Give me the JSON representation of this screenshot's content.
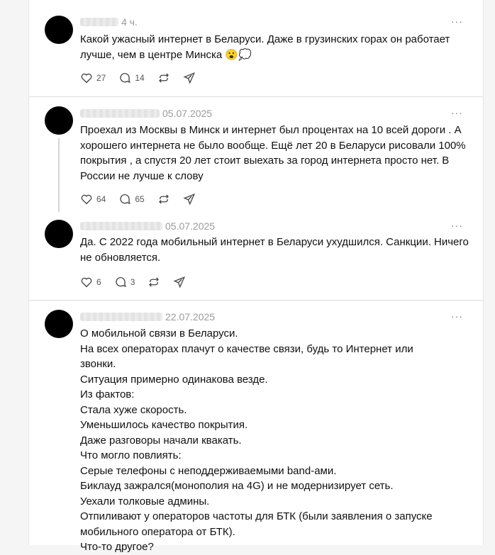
{
  "posts": [
    {
      "time": "4 ч.",
      "text": "Какой ужасный интернет в Беларуси. Даже в грузинских горах он работает лучше, чем в центре Минска 😮💭",
      "likes": "27",
      "replies": "14"
    },
    {
      "time": "05.07.2025",
      "text": "Проехал из Москвы в Минск и интернет был процентах на 10 всей дороги . А хорошего интернета не было вообще. Ещё лет 20 в Беларуси рисовали 100% покрытия , а спустя 20 лет стоит выехать за город интернета просто нет. В России не лучше к слову",
      "likes": "64",
      "replies": "65"
    },
    {
      "time": "05.07.2025",
      "text": "Да. С 2022 года мобильный интернет в Беларуси ухудшился. Санкции. Ничего не обновляется.",
      "likes": "6",
      "replies": "3"
    },
    {
      "time": "22.07.2025",
      "text": "О мобильной связи в Беларуси.\nНа всех операторах плачут о качестве связи, будь то Интернет или звонки.\nСитуация примерно одинакова везде.\nИз фактов:\nСтала хуже скорость.\nУменьшилось качество покрытия.\nДаже разговоры начали квакать.\nЧто могло повлиять:\nСерые телефоны с неподдерживаемыми band-ами.\nБиклауд зажрался(монополия на 4G) и не модернизирует сеть.\nУехали толковые админы.\nОтпиливают у операторов частоты для БТК (были заявления о запуске мобильного оператора от БТК).\nЧто-то другое?"
    }
  ],
  "more_icon": "···",
  "icons": [
    "heart-icon",
    "comment-icon",
    "repost-icon",
    "share-icon",
    "more-icon"
  ]
}
